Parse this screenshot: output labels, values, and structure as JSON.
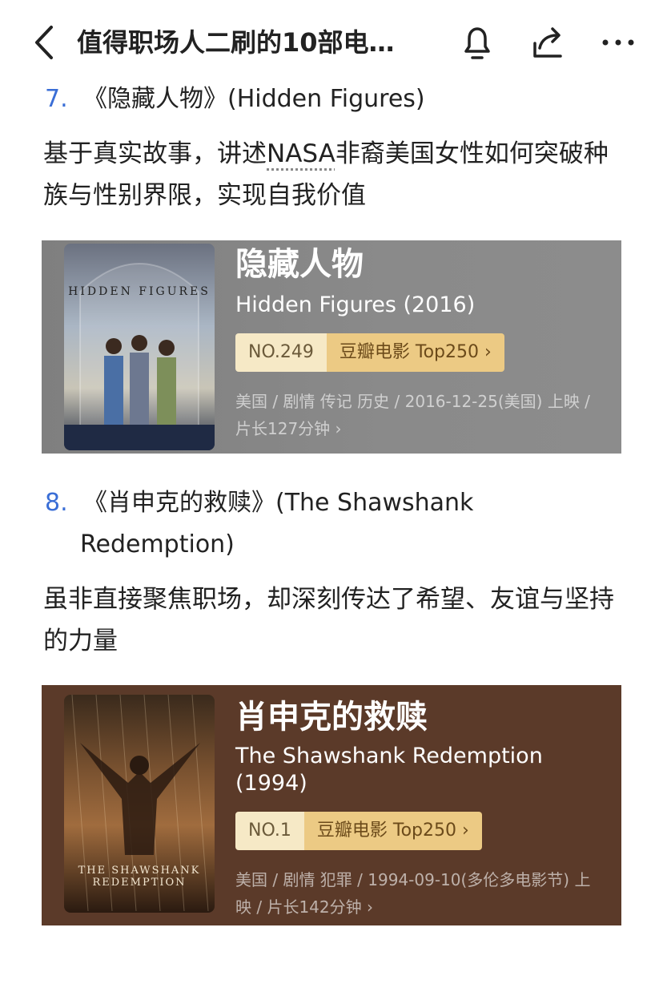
{
  "header": {
    "title": "值得职场人二刷的10部电…",
    "icons": [
      "back-arrow-icon",
      "bell-icon",
      "share-icon",
      "more-icon"
    ]
  },
  "items": [
    {
      "number": "7.",
      "heading": "《隐藏人物》(Hidden Figures)",
      "desc_pre": "基于真实故事，讲述",
      "desc_link": "NASA",
      "desc_post": "非裔美国女性如何突破种族与性别界限，实现自我价值",
      "card": {
        "title": "隐藏人物",
        "subtitle": "Hidden Figures (2016)",
        "rank_no": "NO.249",
        "rank_list": "豆瓣电影 Top250 ›",
        "meta": "美国 / 剧情 传记 历史 / 2016-12-25(美国) 上映 / 片长127分钟 ›",
        "poster_label": "HIDDEN FIGURES"
      }
    },
    {
      "number": "8.",
      "heading_line1": "《肖申克的救赎》(The Shawshank",
      "heading_line2": "Redemption)",
      "desc": "虽非直接聚焦职场，却深刻传达了希望、友谊与坚持的力量",
      "card": {
        "title": "肖申克的救赎",
        "subtitle": "The Shawshank Redemption (1994)",
        "rank_no": "NO.1",
        "rank_list": "豆瓣电影 Top250 ›",
        "meta": "美国 / 剧情 犯罪 / 1994-09-10(多伦多电影节) 上映 / 片长142分钟 ›",
        "poster_label": "THE SHAWSHANK REDEMPTION"
      }
    }
  ]
}
